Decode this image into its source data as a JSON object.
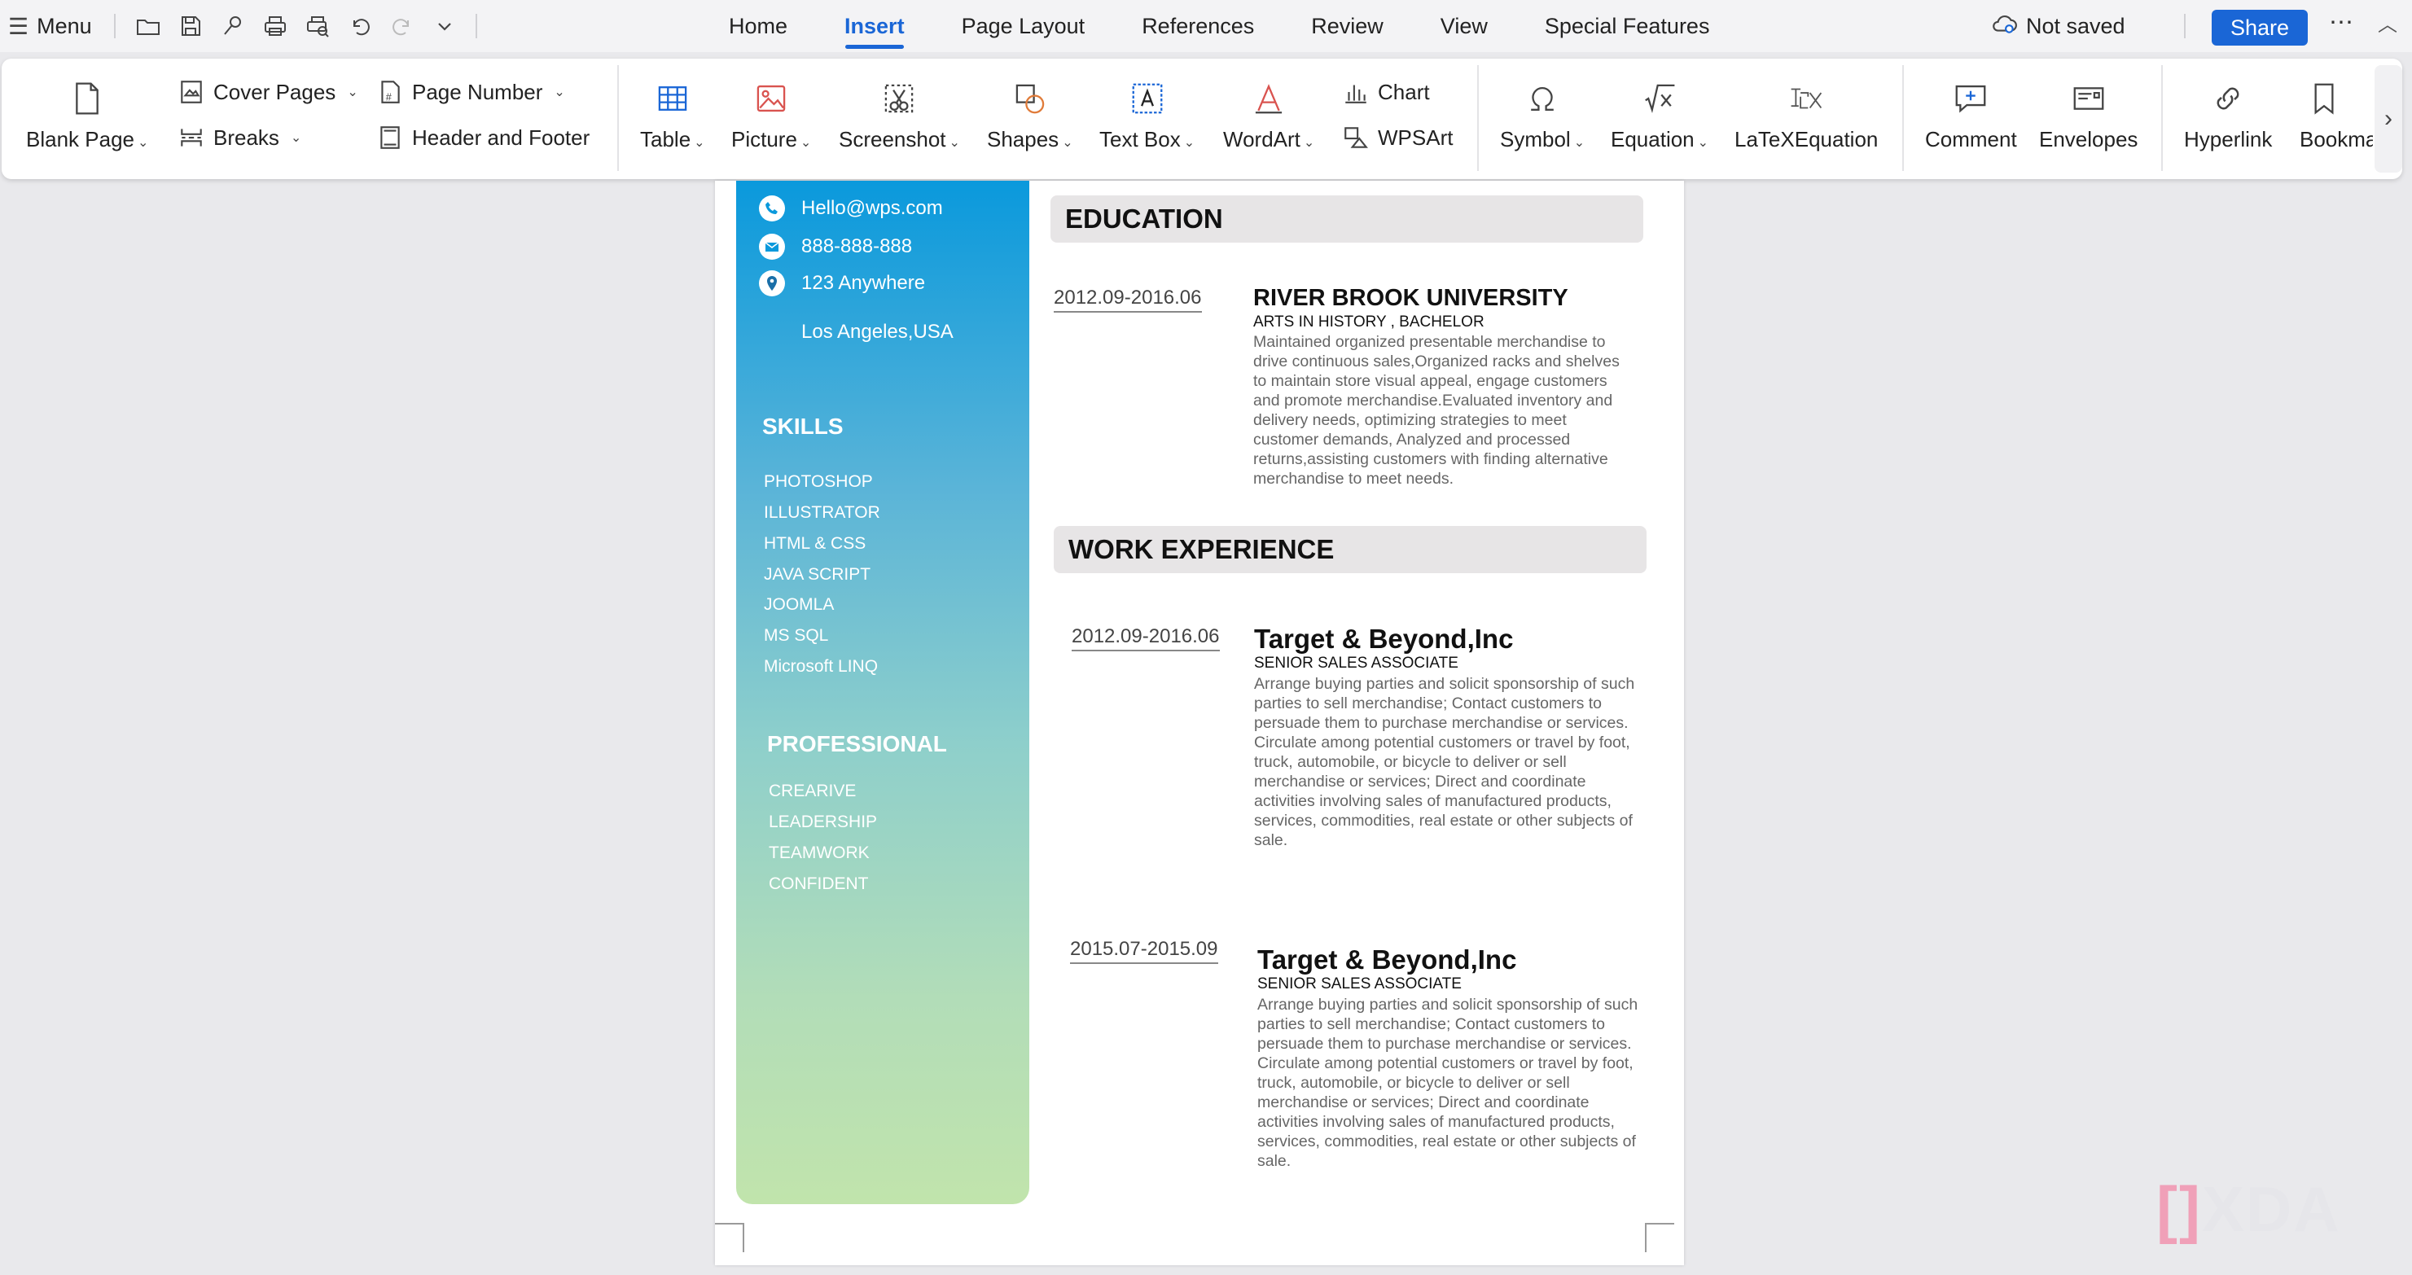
{
  "topbar": {
    "menu_label": "Menu",
    "tabs": [
      "Home",
      "Insert",
      "Page Layout",
      "References",
      "Review",
      "View",
      "Special Features"
    ],
    "active_tab": "Insert",
    "save_status": "Not saved",
    "share_label": "Share",
    "more_label": "⋯"
  },
  "ribbon": {
    "blank_page": "Blank Page",
    "cover_pages": "Cover Pages",
    "breaks": "Breaks",
    "page_number": "Page Number",
    "header_footer": "Header and Footer",
    "table": "Table",
    "picture": "Picture",
    "screenshot": "Screenshot",
    "shapes": "Shapes",
    "text_box": "Text Box",
    "wordart": "WordArt",
    "chart": "Chart",
    "wpsart": "WPSArt",
    "symbol": "Symbol",
    "equation": "Equation",
    "latex": "LaTeXEquation",
    "comment": "Comment",
    "envelopes": "Envelopes",
    "hyperlink": "Hyperlink",
    "bookmark": "Bookma"
  },
  "resume": {
    "contact": {
      "email": "Hello@wps.com",
      "phone": "888-888-888",
      "address1": "123 Anywhere",
      "address2": "Los Angeles,USA"
    },
    "skills_title": "SKILLS",
    "skills": [
      "PHOTOSHOP",
      "ILLUSTRATOR",
      "HTML & CSS",
      "JAVA SCRIPT",
      "JOOMLA",
      "MS SQL",
      "Microsoft LINQ"
    ],
    "professional_title": "PROFESSIONAL",
    "professional": [
      "CREARIVE",
      "LEADERSHIP",
      "TEAMWORK",
      "CONFIDENT"
    ],
    "education_title": "EDUCATION",
    "education": {
      "date": "2012.09-2016.06",
      "school": "RIVER BROOK UNIVERSITY",
      "degree": "ARTS IN HISTORY , BACHELOR",
      "description": "Maintained organized presentable merchandise to drive continuous sales,Organized racks and shelves to maintain store visual appeal, engage customers and promote merchandise.Evaluated inventory and delivery needs, optimizing strategies to meet customer demands, Analyzed and processed returns,assisting customers with finding alternative merchandise to meet needs."
    },
    "work_title": "WORK EXPERIENCE",
    "work": [
      {
        "date": "2012.09-2016.06",
        "company": "Target & Beyond,Inc",
        "role": "SENIOR SALES ASSOCIATE",
        "description": "Arrange buying parties and solicit sponsorship of such parties to sell merchandise; Contact customers to persuade them to purchase merchandise or services. Circulate among potential customers or travel by foot, truck, automobile, or bicycle to deliver or sell merchandise or services; Direct and coordinate activities involving sales of manufactured products, services, commodities, real estate or other subjects of sale."
      },
      {
        "date": "2015.07-2015.09",
        "company": "Target & Beyond,Inc",
        "role": "SENIOR SALES ASSOCIATE",
        "description": "Arrange buying parties and solicit sponsorship of such parties to sell merchandise; Contact customers to persuade them to purchase merchandise or services. Circulate among potential customers or travel by foot, truck, automobile, or bicycle to deliver or sell merchandise or services; Direct and coordinate activities involving sales of manufactured products, services, commodities, real estate or other subjects of sale."
      }
    ]
  },
  "watermark": {
    "brand_mark": "[]",
    "brand_text": "XDA"
  },
  "colors": {
    "accent": "#1a66d6",
    "sidebar_top": "#0a99dc",
    "sidebar_bottom": "#c1e4ac",
    "section_bar": "#e7e5e6"
  }
}
